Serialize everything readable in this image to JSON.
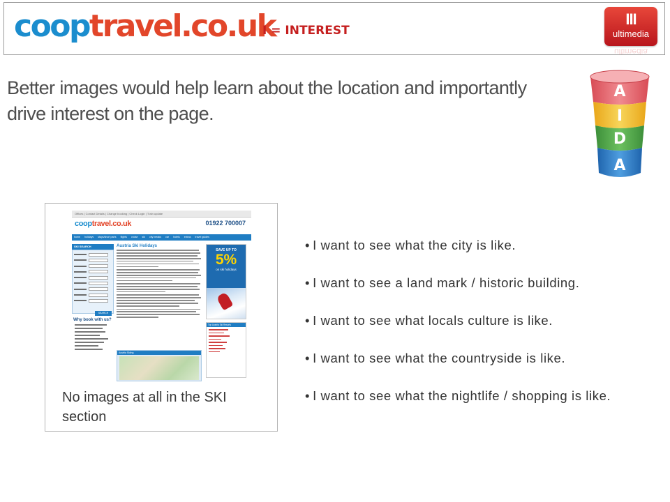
{
  "header": {
    "logo_part1": "coop",
    "logo_part2": "travel.co.uk",
    "slide_tag": "I = INTEREST",
    "brand_logo_text": "ultimedia",
    "brand_logo_mark": "III"
  },
  "headline": "Better images would help learn about the location and importantly drive interest on the page.",
  "aida": {
    "letters": [
      "A",
      "I",
      "D",
      "A"
    ],
    "colors": [
      "#e7656c",
      "#f2c12e",
      "#4fa84a",
      "#2f7ec6"
    ]
  },
  "thumbnail": {
    "site": {
      "util_links": "Offices | Contact Details | Change booking | Check Login | Train update",
      "logo_part1": "coop",
      "logo_part2": "travel.co.uk",
      "phone": "01922 700007",
      "nav": [
        "home",
        "holidays",
        "stays/short parts",
        "flights",
        "cruise",
        "ski",
        "city breaks",
        "car",
        "hotels",
        "extras",
        "travel guides"
      ],
      "sidebar_heading": "SKI SEARCH",
      "search_button": "SEARCH",
      "why_heading": "Why book with us?",
      "main_title": "Austria Ski Holidays",
      "map_heading": "Austria Skiing",
      "ad_line1": "SAVE UP TO",
      "ad_value": "5%",
      "ad_line2": "on ski holidays",
      "ad2_heading": "Top Austria Ski Resorts"
    },
    "caption": "No images at all in the SKI section"
  },
  "bullets": [
    "I want to see what the city is like.",
    "I want to see a land mark / historic building.",
    "I want to see what locals culture is like.",
    "I want to see what the countryside is like.",
    "I want to see what the nightlife / shopping is like."
  ],
  "bullet_symbol": "•"
}
